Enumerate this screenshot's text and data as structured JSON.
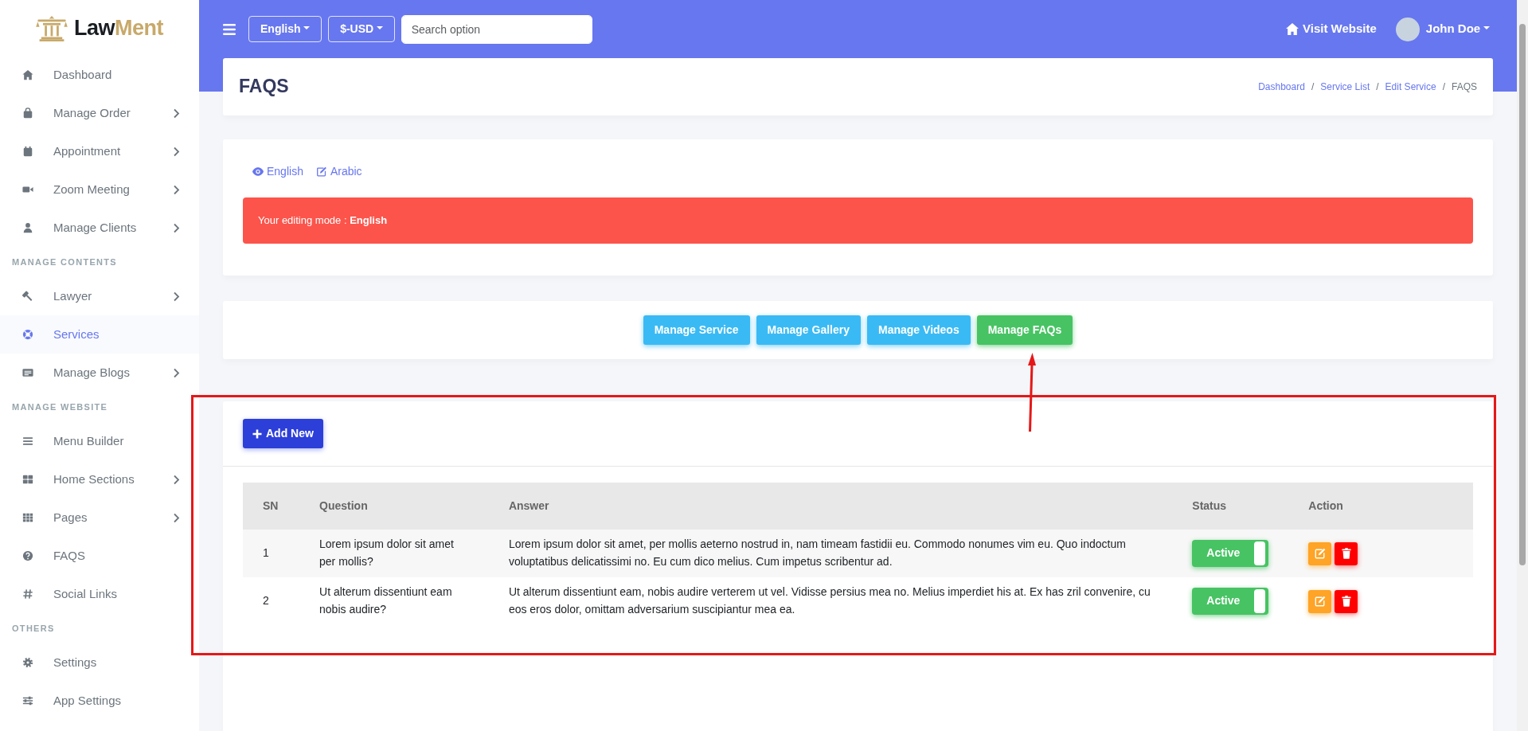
{
  "logo": {
    "part_1": "Law",
    "part_2": "Ment"
  },
  "sidebar": {
    "sections": [
      {
        "items": [
          {
            "label": "Dashboard",
            "selected": false,
            "expandable": false
          },
          {
            "label": "Manage Order",
            "selected": false,
            "expandable": true
          },
          {
            "label": "Appointment",
            "selected": false,
            "expandable": true
          },
          {
            "label": "Zoom Meeting",
            "selected": false,
            "expandable": true
          },
          {
            "label": "Manage Clients",
            "selected": false,
            "expandable": true
          }
        ]
      },
      {
        "heading": "MANAGE CONTENTS",
        "items": [
          {
            "label": "Lawyer",
            "selected": false,
            "expandable": true
          },
          {
            "label": "Services",
            "selected": true,
            "expandable": false
          },
          {
            "label": "Manage Blogs",
            "selected": false,
            "expandable": true
          }
        ]
      },
      {
        "heading": "MANAGE WEBSITE",
        "items": [
          {
            "label": "Menu Builder",
            "selected": false,
            "expandable": false
          },
          {
            "label": "Home Sections",
            "selected": false,
            "expandable": true
          },
          {
            "label": "Pages",
            "selected": false,
            "expandable": true
          },
          {
            "label": "FAQS",
            "selected": false,
            "expandable": false
          },
          {
            "label": "Social Links",
            "selected": false,
            "expandable": false
          }
        ]
      },
      {
        "heading": "OTHERS",
        "items": [
          {
            "label": "Settings",
            "selected": false,
            "expandable": false
          },
          {
            "label": "App Settings",
            "selected": false,
            "expandable": false
          }
        ]
      }
    ]
  },
  "navbar": {
    "language": "English",
    "currency": "$-USD",
    "search": {
      "placeholder": "Search option"
    },
    "visit_link": "Visit Website",
    "user": "John Doe"
  },
  "page_header": {
    "title": "FAQS",
    "separator": "/",
    "breadcrumb": [
      {
        "label": "Dashboard",
        "current": false
      },
      {
        "label": "Service List",
        "current": false
      },
      {
        "label": "Edit Service",
        "current": false
      },
      {
        "label": "FAQS",
        "current": true
      }
    ]
  },
  "language_tabs": [
    {
      "label": "English",
      "kind": "view"
    },
    {
      "label": "Arabic",
      "kind": "edit"
    }
  ],
  "alert": "Your editing mode : **English**",
  "manage_buttons": [
    {
      "label": "Manage Service",
      "selected": false
    },
    {
      "label": "Manage Gallery",
      "selected": false
    },
    {
      "label": "Manage Videos",
      "selected": false
    },
    {
      "label": "Manage FAQs",
      "selected": true
    }
  ],
  "add_button": "Add New",
  "table": {
    "columns": [
      "SN",
      "Question",
      "Answer",
      "Status",
      "Action"
    ],
    "rows": [
      {
        "sn": "1",
        "question": "Lorem ipsum dolor sit amet per mollis?",
        "answer": "Lorem ipsum dolor sit amet, per mollis aeterno nostrud in, nam timeam fastidii eu. Commodo nonumes vim eu. Quo indoctum voluptatibus delicatissimi no. Eu cum dico melius. Cum impetus scribentur ad.",
        "status": {
          "label": "Active",
          "on": true
        }
      },
      {
        "sn": "2",
        "question": "Ut alterum dissentiunt eam nobis audire?",
        "answer": "Ut alterum dissentiunt eam, nobis audire verterem ut vel. Vidisse persius mea no. Melius imperdiet his at. Ex has zril convenire, cu eos eros dolor, omittam adversarium suscipiantur mea ea.",
        "status": {
          "label": "Active",
          "on": true
        }
      }
    ]
  }
}
